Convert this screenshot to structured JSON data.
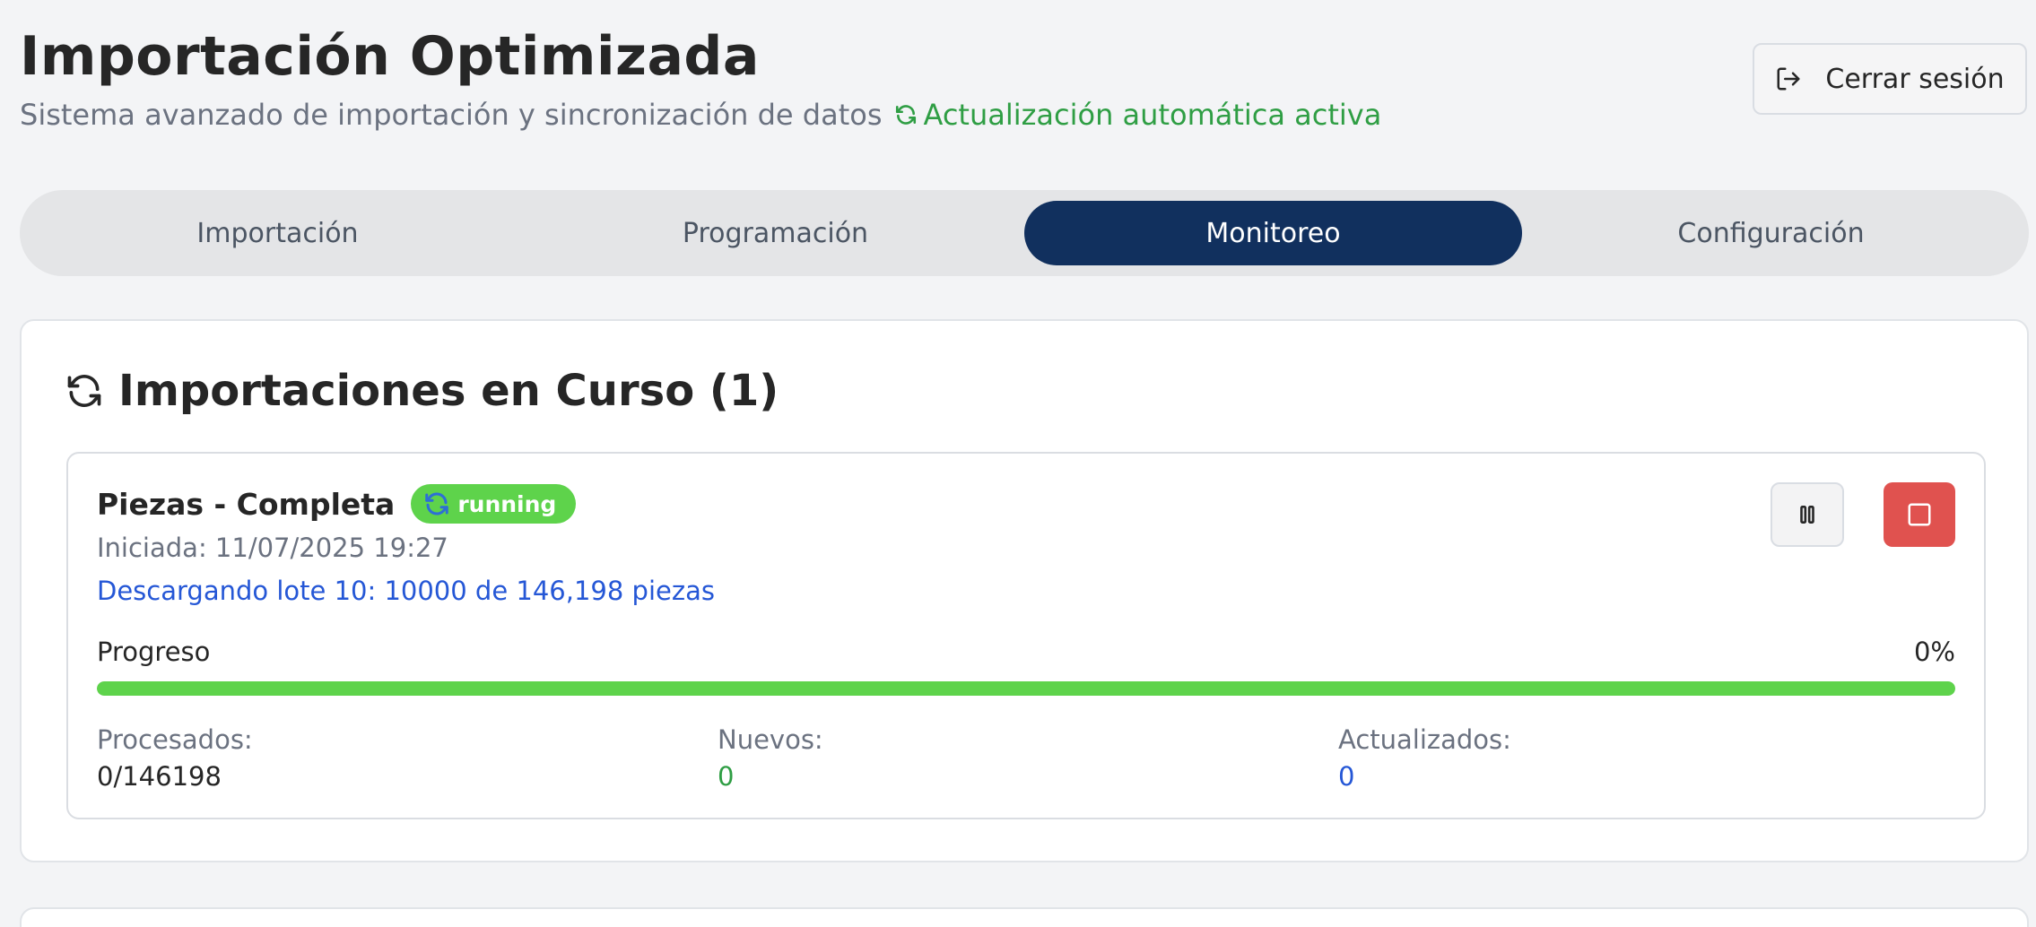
{
  "header": {
    "title": "Importación Optimizada",
    "subtitle": "Sistema avanzado de importación y sincronización de datos",
    "auto_update": "Actualización automática activa",
    "logout_label": "Cerrar sesión",
    "logout_icon": "logout-icon"
  },
  "tabs": [
    {
      "label": "Importación",
      "active": false
    },
    {
      "label": "Programación",
      "active": false
    },
    {
      "label": "Monitoreo",
      "active": true
    },
    {
      "label": "Configuración",
      "active": false
    }
  ],
  "active_imports": {
    "title": "Importaciones en Curso (1)",
    "icon": "refresh-icon",
    "jobs": [
      {
        "name": "Piezas - Completa",
        "status": "running",
        "started": "Iniciada: 11/07/2025 19:27",
        "message": "Descargando lote 10: 10000 de 146,198 piezas",
        "progress_label": "Progreso",
        "progress_text": "0%",
        "progress_bar_fill": 1.0,
        "stats": [
          {
            "label": "Procesados:",
            "value": "0/146198"
          },
          {
            "label": "Nuevos:",
            "value": "0"
          },
          {
            "label": "Actualizados:",
            "value": "0"
          }
        ],
        "actions": [
          "pause-icon",
          "stop-icon"
        ]
      }
    ]
  },
  "colors": {
    "accent_navy": "#11305e",
    "success_green": "#5ed34b",
    "text_green": "#2f9e44",
    "link_blue": "#2557d6",
    "danger_red": "#e0524f"
  }
}
